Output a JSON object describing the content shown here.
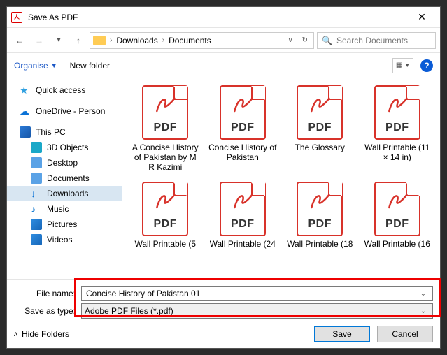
{
  "title": "Save As PDF",
  "breadcrumb": {
    "seg1": "Downloads",
    "seg2": "Documents"
  },
  "search": {
    "placeholder": "Search Documents"
  },
  "toolbar": {
    "organise": "Organise",
    "newfolder": "New folder"
  },
  "sidebar": {
    "quick": "Quick access",
    "onedrive": "OneDrive - Person",
    "thispc": "This PC",
    "items": [
      "3D Objects",
      "Desktop",
      "Documents",
      "Downloads",
      "Music",
      "Pictures",
      "Videos"
    ]
  },
  "files": [
    "A Concise History of Pakistan by M R Kazimi",
    "Concise History of Pakistan",
    "The Glossary",
    "Wall Printable (11 × 14 in)",
    "Wall Printable (5",
    "Wall Printable (24",
    "Wall Printable (18",
    "Wall Printable (16"
  ],
  "pdfLabel": "PDF",
  "form": {
    "filenameLabel": "File name:",
    "filenameValue": "Concise History of Pakistan 01",
    "typeLabel": "Save as type:",
    "typeValue": "Adobe PDF Files (*.pdf)"
  },
  "footer": {
    "hide": "Hide Folders",
    "save": "Save",
    "cancel": "Cancel"
  },
  "help": "?"
}
